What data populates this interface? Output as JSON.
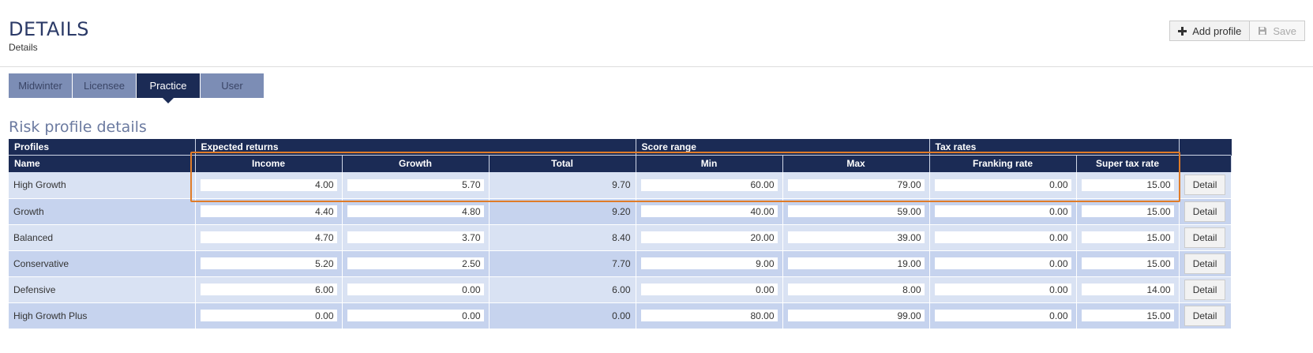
{
  "header": {
    "title": "DETAILS",
    "subtitle": "Details",
    "add_profile_label": "Add profile",
    "save_label": "Save"
  },
  "tabs": [
    {
      "label": "Midwinter",
      "active": false
    },
    {
      "label": "Licensee",
      "active": false
    },
    {
      "label": "Practice",
      "active": true
    },
    {
      "label": "User",
      "active": false
    }
  ],
  "section_title": "Risk profile details",
  "table": {
    "groups": {
      "profiles": "Profiles",
      "expected_returns": "Expected returns",
      "score_range": "Score range",
      "tax_rates": "Tax rates"
    },
    "columns": {
      "name": "Name",
      "income": "Income",
      "growth": "Growth",
      "total": "Total",
      "min": "Min",
      "max": "Max",
      "franking_rate": "Franking rate",
      "super_tax_rate": "Super tax rate"
    },
    "detail_label": "Detail",
    "rows": [
      {
        "name": "High Growth",
        "income": "4.00",
        "growth": "5.70",
        "total": "9.70",
        "min": "60.00",
        "max": "79.00",
        "franking_rate": "0.00",
        "super_tax_rate": "15.00"
      },
      {
        "name": "Growth",
        "income": "4.40",
        "growth": "4.80",
        "total": "9.20",
        "min": "40.00",
        "max": "59.00",
        "franking_rate": "0.00",
        "super_tax_rate": "15.00"
      },
      {
        "name": "Balanced",
        "income": "4.70",
        "growth": "3.70",
        "total": "8.40",
        "min": "20.00",
        "max": "39.00",
        "franking_rate": "0.00",
        "super_tax_rate": "15.00"
      },
      {
        "name": "Conservative",
        "income": "5.20",
        "growth": "2.50",
        "total": "7.70",
        "min": "9.00",
        "max": "19.00",
        "franking_rate": "0.00",
        "super_tax_rate": "15.00"
      },
      {
        "name": "Defensive",
        "income": "6.00",
        "growth": "0.00",
        "total": "6.00",
        "min": "0.00",
        "max": "8.00",
        "franking_rate": "0.00",
        "super_tax_rate": "14.00"
      },
      {
        "name": "High Growth Plus",
        "income": "0.00",
        "growth": "0.00",
        "total": "0.00",
        "min": "80.00",
        "max": "99.00",
        "franking_rate": "0.00",
        "super_tax_rate": "15.00"
      }
    ]
  },
  "colors": {
    "header_navy": "#1b2b55",
    "tab_inactive": "#7c8db5",
    "row_light": "#d9e2f3",
    "row_dark": "#c6d3ee",
    "highlight": "#e07c28"
  },
  "icons": {
    "add": "plus-icon",
    "save": "floppy-disk-icon"
  }
}
